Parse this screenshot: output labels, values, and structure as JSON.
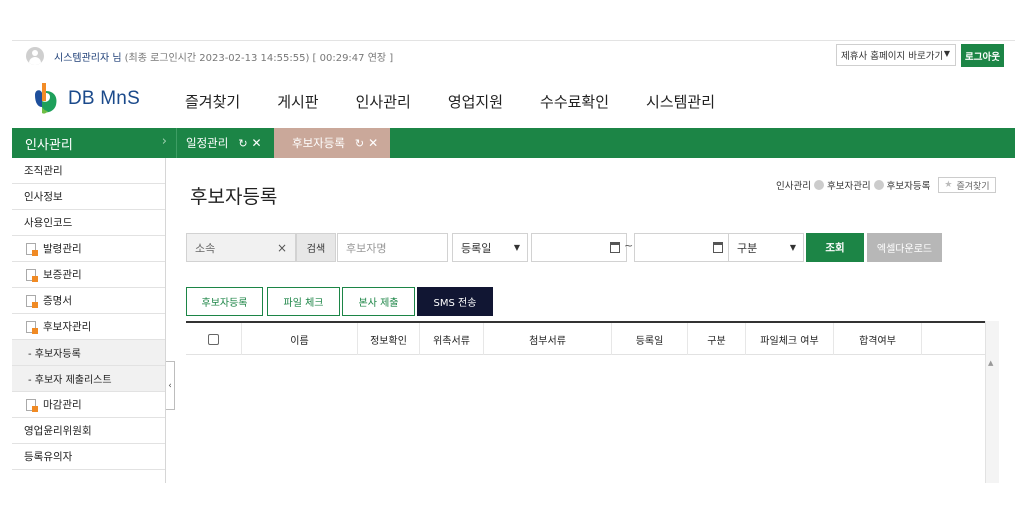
{
  "topbar": {
    "user_name": "시스템관리자 님",
    "login_time": "(최종 로그인시간 2023-02-13 14:55:55) [ 00:29:47 연장 ]",
    "partner_select": "제휴사 홈페이지 바로가기",
    "logout_label": "로그아웃"
  },
  "header": {
    "logo_text": "DB MnS",
    "gnb": [
      "즐겨찾기",
      "게시판",
      "인사관리",
      "영업지원",
      "수수료확인",
      "시스템관리"
    ]
  },
  "tabs": {
    "menu_title": "인사관리",
    "tab_1": "일정관리",
    "tab_2": "후보자등록"
  },
  "sidebar": {
    "items": [
      "조직관리",
      "인사정보",
      "사용인코드",
      "발령관리",
      "보증관리",
      "증명서",
      "후보자관리",
      "- 후보자등록",
      "- 후보자 제출리스트",
      "마감관리",
      "영업윤리위원회",
      "등록유의자"
    ]
  },
  "page": {
    "title": "후보자등록",
    "breadcrumb": [
      "인사관리",
      "후보자관리",
      "후보자등록"
    ],
    "favorite_label": "즐겨찾기"
  },
  "search": {
    "org_value": "소속",
    "search_label": "검색",
    "name_placeholder": "후보자명",
    "date_type": "등록일",
    "tilde": "~",
    "gubun": "구분",
    "query_label": "조회",
    "excel_label": "엑셀다운로드"
  },
  "actions": {
    "register": "후보자등록",
    "file_check": "파일 체크",
    "hq_submit": "본사 제출",
    "sms": "SMS 전송"
  },
  "grid": {
    "columns": [
      "이름",
      "정보확인",
      "위촉서류",
      "첨부서류",
      "등록일",
      "구분",
      "파일체크 여부",
      "합격여부"
    ]
  },
  "colors": {
    "brand_green": "#1c8546",
    "active_tab": "#caa89a",
    "sms_button": "#111633"
  }
}
